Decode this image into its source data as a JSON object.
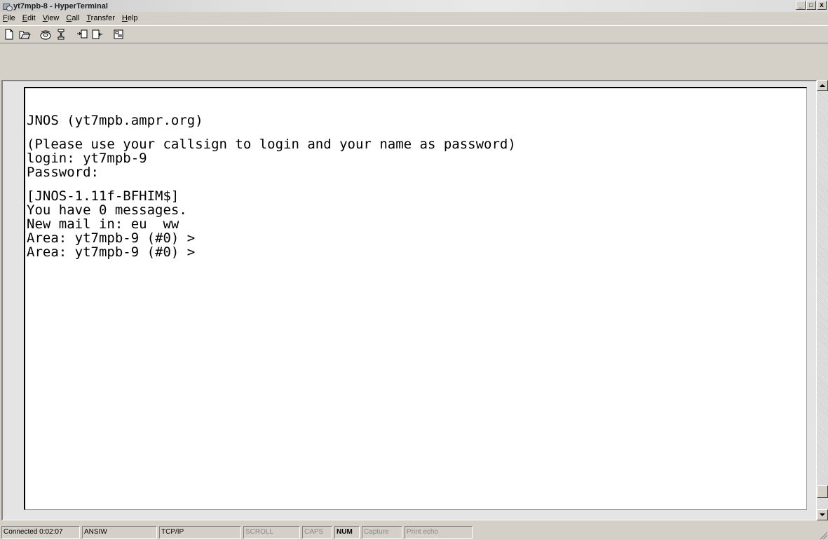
{
  "window": {
    "title": "yt7mpb-8 - HyperTerminal"
  },
  "caption_buttons": {
    "minimize": "_",
    "maximize": "□",
    "close": "x"
  },
  "menu": [
    {
      "label": "File",
      "mnemonic": "F",
      "rest": "ile"
    },
    {
      "label": "Edit",
      "mnemonic": "E",
      "rest": "dit"
    },
    {
      "label": "View",
      "mnemonic": "V",
      "rest": "iew"
    },
    {
      "label": "Call",
      "mnemonic": "C",
      "rest": "all"
    },
    {
      "label": "Transfer",
      "mnemonic": "T",
      "rest": "ransfer"
    },
    {
      "label": "Help",
      "mnemonic": "H",
      "rest": "elp"
    }
  ],
  "toolbar": {
    "icons": [
      "new-icon",
      "open-icon",
      "call-icon",
      "disconnect-icon",
      "send-icon",
      "receive-icon",
      "properties-icon"
    ]
  },
  "terminal": {
    "lines": [
      "JNOS (yt7mpb.ampr.org)",
      "",
      "(Please use your callsign to login and your name as password)",
      "login: yt7mpb-9",
      "Password:",
      "",
      "[JNOS-1.11f-BFHIM$]",
      "You have 0 messages.",
      "New mail in: eu  ww",
      "Area: yt7mpb-9 (#0) >",
      "Area: yt7mpb-9 (#0) >"
    ]
  },
  "statusbar": {
    "connected": "Connected 0:02:07",
    "emulation": "ANSIW",
    "protocol": "TCP/IP",
    "scroll": "SCROLL",
    "caps": "CAPS",
    "num": "NUM",
    "capture": "Capture",
    "print_echo": "Print echo"
  }
}
